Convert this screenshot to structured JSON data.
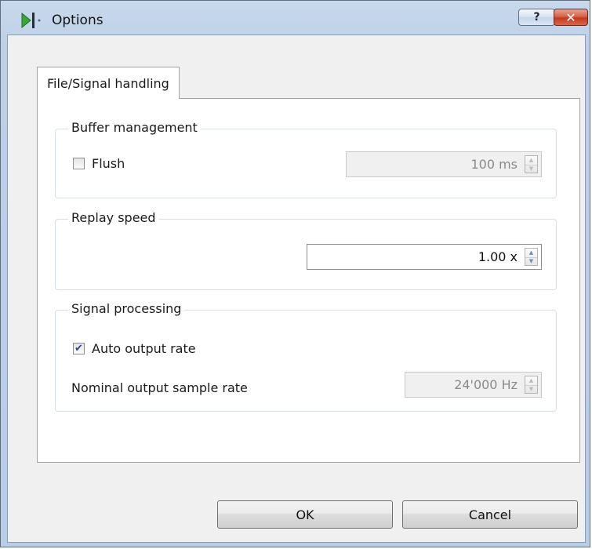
{
  "window": {
    "title": "Options",
    "help_label": "?",
    "close_label": "✕",
    "app_icon": "play-bar-icon",
    "accent_color": "#3aa63a"
  },
  "tabs": [
    {
      "label": "File/Signal handling",
      "selected": true
    }
  ],
  "buffer_management": {
    "title": "Buffer management",
    "flush_label": "Flush",
    "flush_checked": false,
    "flush_value": "100 ms",
    "flush_enabled": false
  },
  "replay_speed": {
    "title": "Replay speed",
    "value": "1.00 x",
    "enabled": true
  },
  "signal_processing": {
    "title": "Signal processing",
    "auto_rate_label": "Auto output rate",
    "auto_rate_checked": true,
    "nominal_rate_label": "Nominal output sample rate",
    "nominal_rate_value": "24'000 Hz",
    "nominal_rate_enabled": false
  },
  "buttons": {
    "ok_label": "OK",
    "cancel_label": "Cancel"
  }
}
